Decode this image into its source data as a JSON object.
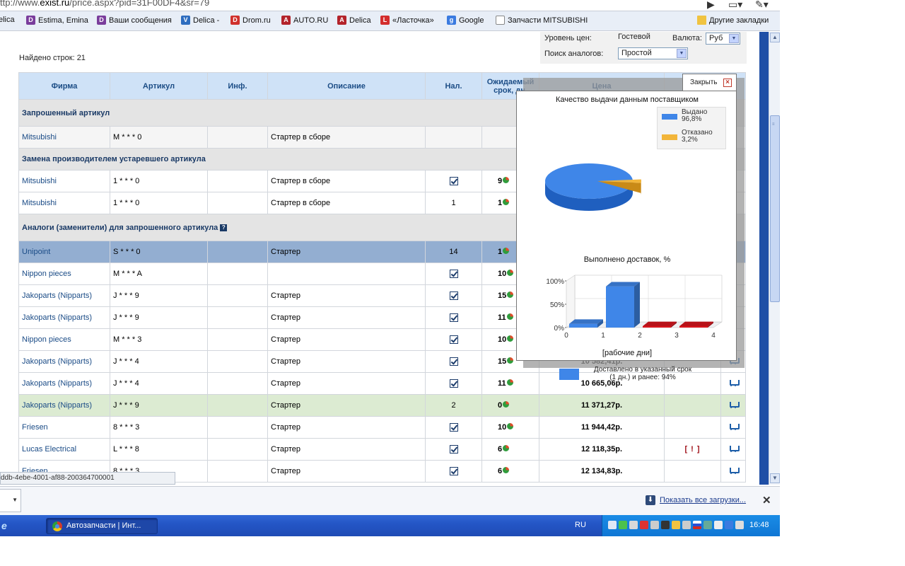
{
  "browser": {
    "url_prefix": "ttp://www.",
    "url_domain": "exist.ru",
    "url_path": "/price.aspx?pid=31F00DF4&sr=79",
    "bookmarks": [
      {
        "label": "elica",
        "color": "#5b7fb8",
        "glyph": ""
      },
      {
        "label": "Estima, Emina",
        "color": "#7a3d9c",
        "glyph": "D"
      },
      {
        "label": "Ваши сообщения",
        "color": "#7a3d9c",
        "glyph": "D"
      },
      {
        "label": "Delica -",
        "color": "#2e6dbf",
        "glyph": "V"
      },
      {
        "label": "Drom.ru",
        "color": "#d0312d",
        "glyph": "D"
      },
      {
        "label": "AUTO.RU",
        "color": "#b3232b",
        "glyph": "A"
      },
      {
        "label": "Delica",
        "color": "#b3232b",
        "glyph": "A"
      },
      {
        "label": "«Ласточка»",
        "color": "#d32d2d",
        "glyph": "L"
      },
      {
        "label": "Google",
        "color": "#3b7be0",
        "glyph": "g"
      },
      {
        "label": "Запчасти MITSUBISHI",
        "color": "#ffffff",
        "glyph": ""
      }
    ],
    "other_bookmarks": "Другие закладки"
  },
  "page": {
    "found_rows": "Найдено строк: 21",
    "filters": {
      "price_level_label": "Уровень цен:",
      "price_level_value": "Гостевой",
      "currency_label": "Валюта:",
      "currency_value": "Руб",
      "analog_search_label": "Поиск аналогов:",
      "analog_search_value": "Простой"
    },
    "table": {
      "headers": {
        "firm": "Фирма",
        "article": "Артикул",
        "info": "Инф.",
        "description": "Описание",
        "availability": "Нал.",
        "expected": "Ожидаемый срок, дн.",
        "price": "Цена"
      },
      "sections": {
        "requested": "Запрошенный артикул",
        "replacement": "Замена производителем устаревшего артикула",
        "analogs": "Аналоги (заменители) для запрошенного артикула"
      },
      "requested_rows": [
        {
          "firm": "Mitsubishi",
          "article": "M * * * 0",
          "desc": "Стартер в сборе",
          "avail": "",
          "days": "---"
        }
      ],
      "replacement_rows": [
        {
          "firm": "Mitsubishi",
          "article": "1 * * * 0",
          "desc": "Стартер в сборе",
          "avail": "check",
          "days": "9"
        },
        {
          "firm": "Mitsubishi",
          "article": "1 * * * 0",
          "desc": "Стартер в сборе",
          "avail": "1",
          "days": "1"
        }
      ],
      "analog_rows": [
        {
          "firm": "Unipoint",
          "article": "S * * * 0",
          "desc": "Стартер",
          "avail": "14",
          "days": "1",
          "price": "",
          "warn": "",
          "style": "hl"
        },
        {
          "firm": "Nippon pieces",
          "article": "M * * * A",
          "desc": "",
          "avail": "check",
          "days": "10",
          "price": "",
          "warn": "",
          "style": ""
        },
        {
          "firm": "Jakoparts (Nipparts)",
          "article": "J * * * 9",
          "desc": "Стартер",
          "avail": "check",
          "days": "15",
          "price": "",
          "warn": "",
          "style": ""
        },
        {
          "firm": "Jakoparts (Nipparts)",
          "article": "J * * * 9",
          "desc": "Стартер",
          "avail": "check",
          "days": "11",
          "price": "",
          "warn": "",
          "style": ""
        },
        {
          "firm": "Nippon pieces",
          "article": "M * * * 3",
          "desc": "Стартер",
          "avail": "check",
          "days": "10",
          "price": "",
          "warn": "",
          "style": ""
        },
        {
          "firm": "Jakoparts (Nipparts)",
          "article": "J * * * 4",
          "desc": "Стартер",
          "avail": "check",
          "days": "15",
          "price": "10 582,41р.",
          "warn": "",
          "style": ""
        },
        {
          "firm": "Jakoparts (Nipparts)",
          "article": "J * * * 4",
          "desc": "Стартер",
          "avail": "check",
          "days": "11",
          "price": "10 665,06р.",
          "warn": "",
          "style": ""
        },
        {
          "firm": "Jakoparts (Nipparts)",
          "article": "J * * * 9",
          "desc": "Стартер",
          "avail": "2",
          "days": "0",
          "price": "11 371,27р.",
          "warn": "",
          "style": "green"
        },
        {
          "firm": "Friesen",
          "article": "8 * * * 3",
          "desc": "Стартер",
          "avail": "check",
          "days": "10",
          "price": "11 944,42р.",
          "warn": "",
          "style": ""
        },
        {
          "firm": "Lucas Electrical",
          "article": "L * * * 8",
          "desc": "Стартер",
          "avail": "check",
          "days": "6",
          "price": "12 118,35р.",
          "warn": "[ ! ]",
          "style": ""
        },
        {
          "firm": "Friesen",
          "article": "8 * * * 3",
          "desc": "Стартер",
          "avail": "check",
          "days": "6",
          "price": "12 134,83р.",
          "warn": "",
          "style": ""
        }
      ]
    }
  },
  "popup": {
    "close_label": "Закрыть",
    "chart_data": [
      {
        "type": "pie",
        "title": "Качество выдачи данным поставщиком",
        "slices": [
          {
            "name": "Выдано",
            "value_label": "96,8%",
            "value": 96.8,
            "color": "#3f86e8"
          },
          {
            "name": "Отказано",
            "value_label": "3,2%",
            "value": 3.2,
            "color": "#f2b53a"
          }
        ]
      },
      {
        "type": "bar",
        "title": "Выполнено доставок, %",
        "categories": [
          "0",
          "1",
          "2",
          "3",
          "4"
        ],
        "values": [
          8,
          88,
          3,
          3
        ],
        "bar_colors": [
          "#3f86e8",
          "#3f86e8",
          "#d9141c",
          "#d9141c"
        ],
        "yticks": [
          "100%",
          "50%",
          "0%"
        ],
        "ylim": [
          0,
          100
        ],
        "xlabel": "[рабочие дни]",
        "legend": "Доставлено в указанный срок (1 дн.) и ранее: 94%",
        "legend_color": "#3f86e8"
      }
    ]
  },
  "status": {
    "link_text": "ddb-4ebe-4001-af88-200364700001"
  },
  "downloads": {
    "show_all": "Показать все загрузки..."
  },
  "taskbar": {
    "window_title": "Автозапчасти | Инт...",
    "language": "RU",
    "clock": "16:48"
  }
}
